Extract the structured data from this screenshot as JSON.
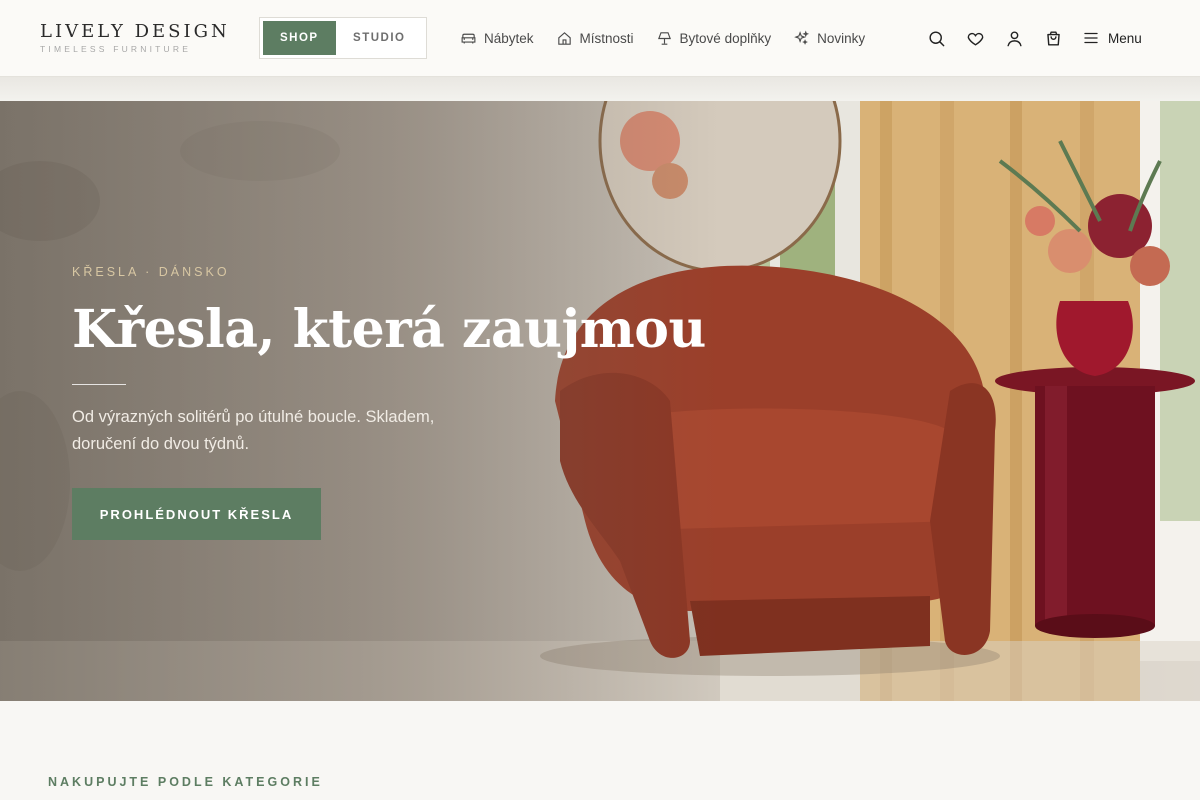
{
  "logo": {
    "title": "LIVELY DESIGN",
    "subtitle": "TIMELESS FURNITURE"
  },
  "switch": {
    "shop": "SHOP",
    "studio": "STUDIO"
  },
  "nav": {
    "items": [
      {
        "label": "Nábytek",
        "icon": "sofa-icon"
      },
      {
        "label": "Místnosti",
        "icon": "home-icon"
      },
      {
        "label": "Bytové doplňky",
        "icon": "lamp-icon"
      },
      {
        "label": "Novinky",
        "icon": "sparkle-icon"
      }
    ]
  },
  "header_icons": [
    "search-icon",
    "heart-icon",
    "user-icon",
    "cart-icon"
  ],
  "menu": {
    "label": "Menu",
    "icon": "hamburger-icon"
  },
  "hero": {
    "eyebrow": "KŘESLA · DÁNSKO",
    "title": "Křesla, která zaujmou",
    "text": "Od výrazných solitérů po útulné boucle. Skladem, doručení do dvou týdnů.",
    "cta": "PROHLÉDNOUT KŘESLA"
  },
  "categories": {
    "title": "NAKUPUJTE PODLE KATEGORIE"
  },
  "colors": {
    "accent": "#5d7d62",
    "eyebrow": "#d8c7a3",
    "background": "#f8f7f4"
  }
}
